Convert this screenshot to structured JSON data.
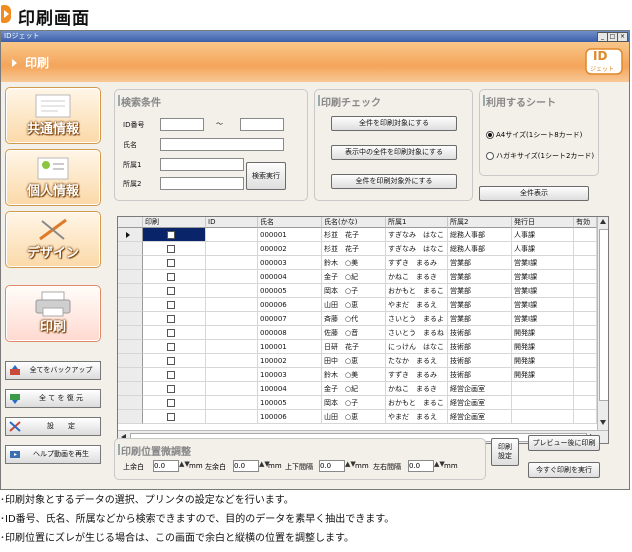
{
  "page": {
    "title": "印刷画面"
  },
  "window": {
    "title": "IDジェット",
    "min": "_",
    "max": "□",
    "close": "×"
  },
  "banner": {
    "title": "印刷",
    "logo": "ID",
    "logo_sub": "ジェット"
  },
  "sidebar": {
    "nav": [
      {
        "label": "共通情報"
      },
      {
        "label": "個人情報"
      },
      {
        "label": "デザイン"
      },
      {
        "label": "印刷"
      }
    ],
    "actions": [
      {
        "label": "全てをバックアップ"
      },
      {
        "label": "全 て を 復 元"
      },
      {
        "label": "設　　定"
      },
      {
        "label": "ヘルプ動画を再生"
      }
    ]
  },
  "search": {
    "title": "検索条件",
    "id_label": "ID番号",
    "tilde": "～",
    "name_label": "氏名",
    "dept1_label": "所属1",
    "dept2_label": "所属2",
    "run": "検索実行"
  },
  "print_check": {
    "title": "印刷チェック",
    "all_on": "全件を印刷対象にする",
    "shown_on": "表示中の全件を印刷対象にする",
    "all_off": "全件を印刷対象外にする"
  },
  "sheet": {
    "title": "利用するシート",
    "a4": "A4サイズ(1シート8カード)",
    "postcard": "ハガキサイズ(1シート2カード)",
    "show_all": "全件表示"
  },
  "table": {
    "columns": [
      "印刷",
      "ID",
      "氏名",
      "氏名(かな)",
      "所属1",
      "所属2",
      "発行日",
      "有効"
    ],
    "rows": [
      [
        "",
        "000001",
        "杉並　花子",
        "すぎなみ　はなこ",
        "総務人事部",
        "人事課",
        ""
      ],
      [
        "",
        "000002",
        "杉並　花子",
        "すぎなみ　はなこ",
        "総務人事部",
        "人事課",
        ""
      ],
      [
        "",
        "000003",
        "鈴木　○美",
        "すずき　まるみ",
        "営業部",
        "営業Ⅰ課",
        ""
      ],
      [
        "",
        "000004",
        "金子　○紀",
        "かねこ　まるき",
        "営業部",
        "営業Ⅰ課",
        ""
      ],
      [
        "",
        "000005",
        "岡本　○子",
        "おかもと　まるこ",
        "営業部",
        "営業Ⅰ課",
        ""
      ],
      [
        "",
        "000006",
        "山田　○恵",
        "やまだ　まるえ",
        "営業部",
        "営業Ⅰ課",
        ""
      ],
      [
        "",
        "000007",
        "斉藤　○代",
        "さいとう　まるよ",
        "営業部",
        "営業Ⅰ課",
        ""
      ],
      [
        "",
        "000008",
        "佐藤　○音",
        "さいとう　まるね",
        "技術部",
        "開発課",
        ""
      ],
      [
        "",
        "100001",
        "日研　花子",
        "にっけん　はなこ",
        "技術部",
        "開発課",
        ""
      ],
      [
        "",
        "100002",
        "田中　○恵",
        "たなか　まるえ",
        "技術部",
        "開発課",
        ""
      ],
      [
        "",
        "100003",
        "鈴木　○美",
        "すずき　まるみ",
        "技術部",
        "開発課",
        ""
      ],
      [
        "",
        "100004",
        "金子　○紀",
        "かねこ　まるき",
        "経営企画室",
        "",
        ""
      ],
      [
        "",
        "100005",
        "岡本　○子",
        "おかもと　まるこ",
        "経営企画室",
        "",
        ""
      ],
      [
        "",
        "100006",
        "山田　○恵",
        "やまだ　まるえ",
        "経営企画室",
        "",
        ""
      ]
    ]
  },
  "adjust": {
    "title": "印刷位置微調整",
    "top_label": "上余白",
    "left_label": "左余白",
    "vgap_label": "上下間隔",
    "hgap_label": "左右間隔",
    "top": "0.0",
    "left": "0.0",
    "vgap": "0.0",
    "hgap": "0.0",
    "unit": "mm"
  },
  "print_buttons": {
    "settings": "印刷\n設定",
    "preview": "プレビュー後に印刷",
    "now": "今すぐ印刷を実行"
  },
  "notes": [
    "･印刷対象とするデータの選択、プリンタの設定などを行います。",
    "･ID番号、氏名、所属などから検索できますので、目的のデータを素早く抽出できます。",
    "･印刷位置にズレが生じる場合は、この画面で余白と縦横の位置を調整します。"
  ],
  "colors": {
    "accent": "#f28c1e",
    "banner": "#f4a55a",
    "titlebar": "#3d5fa8"
  }
}
